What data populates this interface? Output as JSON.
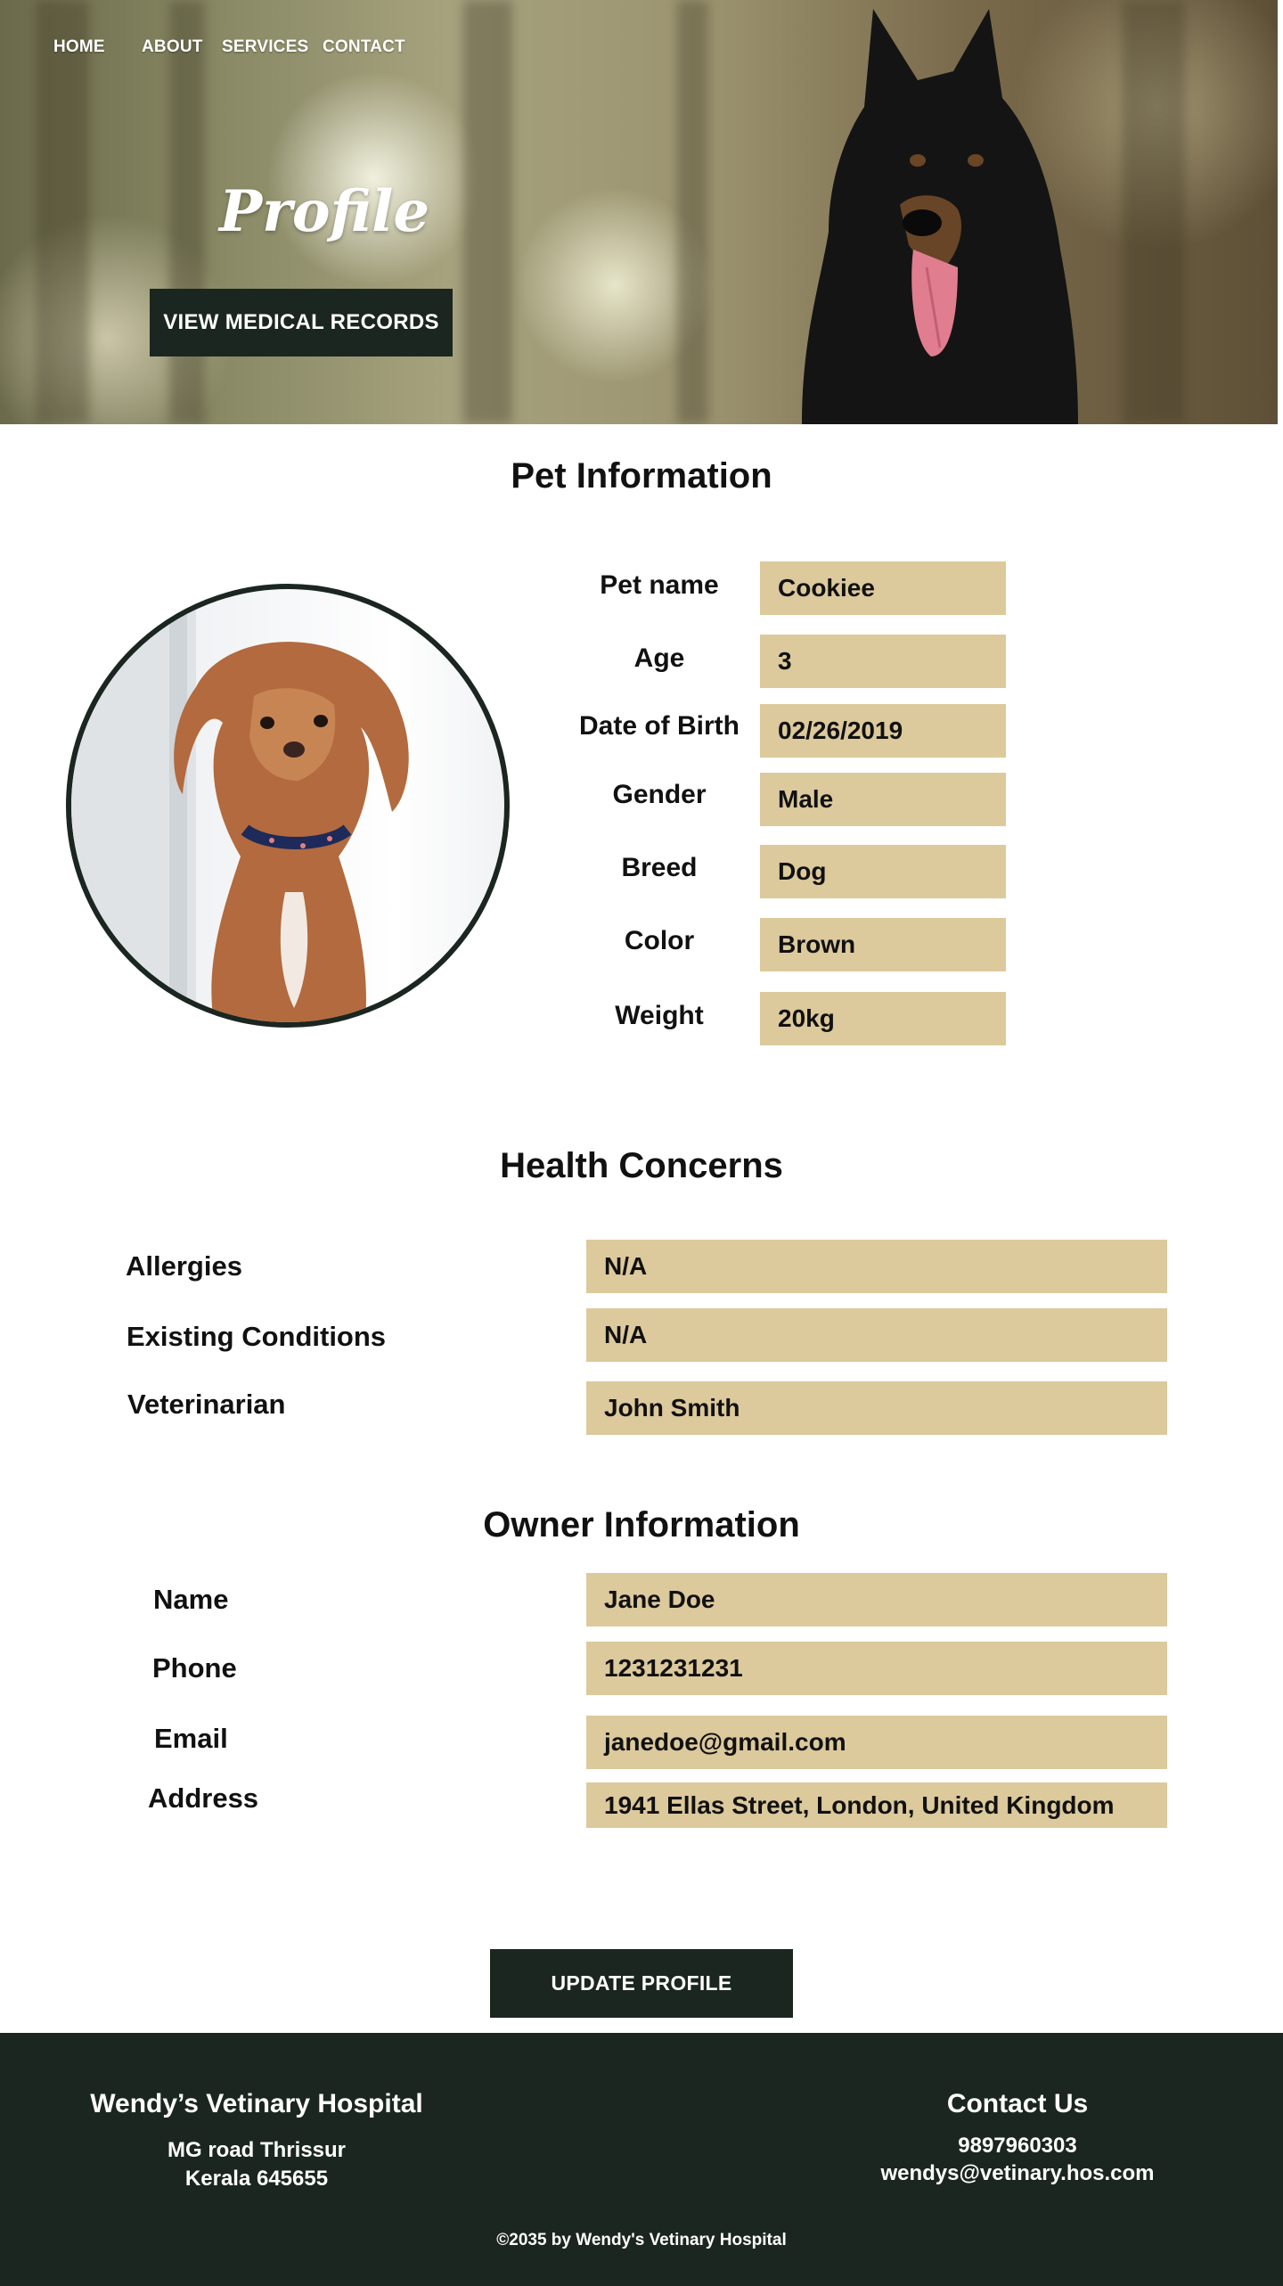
{
  "nav": {
    "home": "HOME",
    "about": "ABOUT",
    "services": "SERVICES",
    "contact": "CONTACT"
  },
  "hero": {
    "title": "Profile",
    "records_button": "VIEW MEDICAL RECORDS"
  },
  "pet_info": {
    "heading": "Pet Information",
    "fields": [
      {
        "label": "Pet name",
        "value": "Cookiee"
      },
      {
        "label": "Age",
        "value": "3"
      },
      {
        "label": "Date of Birth",
        "value": "02/26/2019"
      },
      {
        "label": "Gender",
        "value": "Male"
      },
      {
        "label": "Breed",
        "value": "Dog"
      },
      {
        "label": "Color",
        "value": "Brown"
      },
      {
        "label": "Weight",
        "value": "20kg"
      }
    ]
  },
  "health": {
    "heading": "Health Concerns",
    "fields": [
      {
        "label": "Allergies",
        "value": "N/A"
      },
      {
        "label": "Existing Conditions",
        "value": "N/A"
      },
      {
        "label": "Veterinarian",
        "value": "John Smith"
      }
    ]
  },
  "owner": {
    "heading": "Owner Information",
    "fields": [
      {
        "label": "Name",
        "value": "Jane Doe"
      },
      {
        "label": "Phone",
        "value": "1231231231"
      },
      {
        "label": "Email",
        "value": "janedoe@gmail.com"
      },
      {
        "label": "Address",
        "value": "1941 Ellas Street, London, United Kingdom"
      }
    ]
  },
  "update_button": "UPDATE PROFILE",
  "footer": {
    "hospital_name": "Wendy’s Vetinary Hospital",
    "address_line1": "MG road Thrissur",
    "address_line2": "Kerala 645655",
    "contact_heading": "Contact Us",
    "phone": "9897960303",
    "email": "wendys@vetinary.hos.com",
    "copyright": "©2035 by Wendy's Vetinary Hospital"
  },
  "colors": {
    "dark_green": "#1b2620",
    "field_tan": "#dcc99c"
  }
}
